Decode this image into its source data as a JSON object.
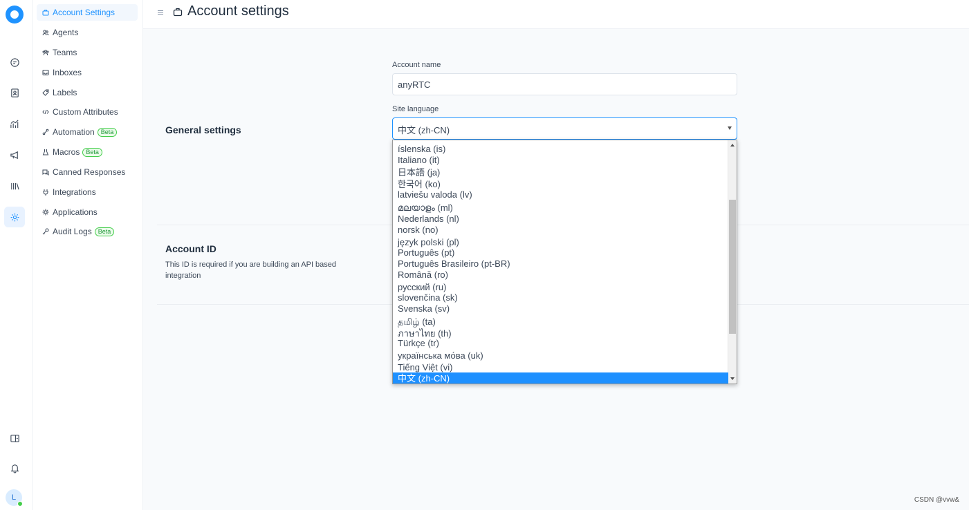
{
  "header": {
    "title": "Account settings"
  },
  "sidebar": {
    "items": [
      {
        "label": "Account Settings",
        "icon": "briefcase-icon",
        "beta": ""
      },
      {
        "label": "Agents",
        "icon": "people-icon",
        "beta": ""
      },
      {
        "label": "Teams",
        "icon": "team-icon",
        "beta": ""
      },
      {
        "label": "Inboxes",
        "icon": "inbox-icon",
        "beta": ""
      },
      {
        "label": "Labels",
        "icon": "tag-icon",
        "beta": ""
      },
      {
        "label": "Custom Attributes",
        "icon": "code-icon",
        "beta": ""
      },
      {
        "label": "Automation",
        "icon": "automation-icon",
        "beta": "Beta"
      },
      {
        "label": "Macros",
        "icon": "flask-icon",
        "beta": "Beta"
      },
      {
        "label": "Canned Responses",
        "icon": "chat-multiple-icon",
        "beta": ""
      },
      {
        "label": "Integrations",
        "icon": "plug-icon",
        "beta": ""
      },
      {
        "label": "Applications",
        "icon": "apps-icon",
        "beta": ""
      },
      {
        "label": "Audit Logs",
        "icon": "key-icon",
        "beta": "Beta"
      }
    ]
  },
  "general": {
    "title": "General settings",
    "account_name_label": "Account name",
    "account_name_value": "anyRTC",
    "site_language_label": "Site language",
    "site_language_value": "中文 (zh-CN)"
  },
  "account_id": {
    "title": "Account ID",
    "description": "This ID is required if you are building an API based integration"
  },
  "language_options": [
    "íslenska (is)",
    "Italiano (it)",
    "日本語 (ja)",
    "한국어 (ko)",
    "latviešu valoda (lv)",
    "മലയാളം (ml)",
    "Nederlands (nl)",
    "norsk (no)",
    "język polski (pl)",
    "Português (pt)",
    "Português Brasileiro (pt-BR)",
    "Română (ro)",
    "русский (ru)",
    "slovenčina (sk)",
    "Svenska (sv)",
    "தமிழ் (ta)",
    "ภาษาไทย (th)",
    "Türkçe (tr)",
    "українська мо́ва (uk)",
    "Tiếng Việt (vi)",
    "中文 (zh-CN)"
  ],
  "selected_language_index": 20,
  "scroll": {
    "position_fraction": 0.55
  },
  "avatar_initial": "L",
  "watermark": "CSDN @vvw&",
  "colors": {
    "accent": "#1f93ff",
    "selected_option": "#1e90ff",
    "beta_green": "#44ce4b"
  }
}
